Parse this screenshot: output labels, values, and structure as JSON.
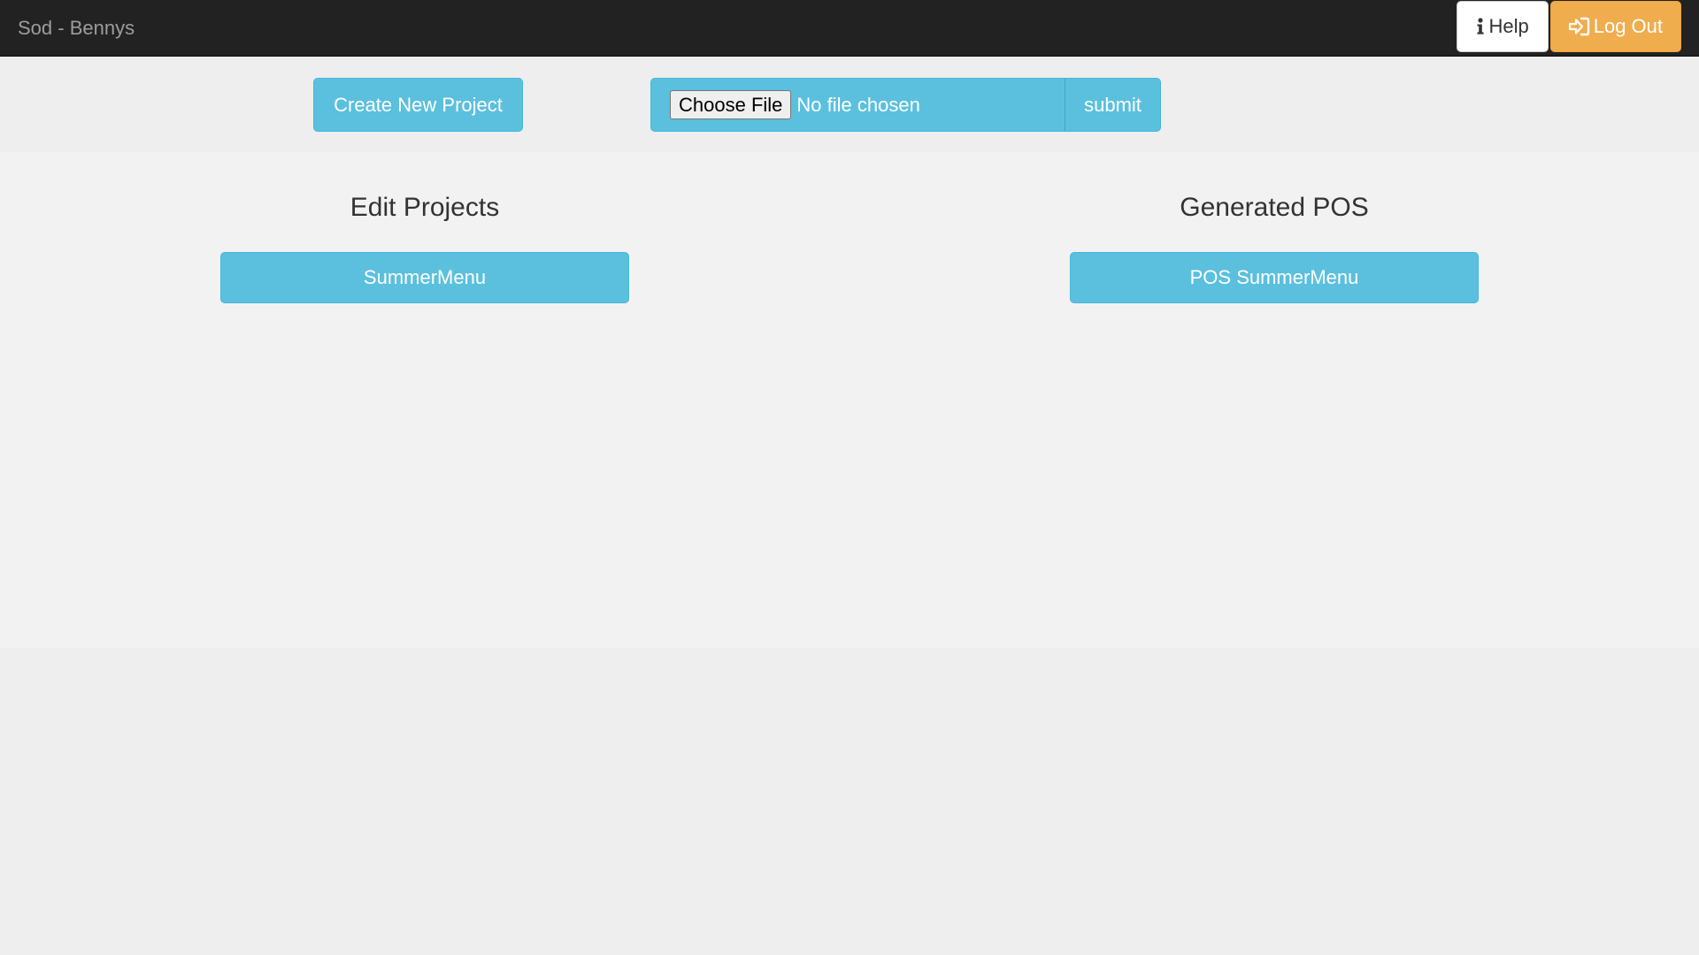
{
  "navbar": {
    "brand": "Sod - Bennys",
    "help_label": "Help",
    "help_icon": "info-icon",
    "logout_label": "Log Out",
    "logout_icon": "sign-in-icon",
    "background_color": "#222222",
    "logout_color": "#f0ad4e"
  },
  "toolbar": {
    "create_label": "Create New Project",
    "choose_file_label": "Choose File",
    "file_status": "No file chosen",
    "submit_label": "submit",
    "accent_color": "#5bc0de"
  },
  "edit_projects": {
    "title": "Edit Projects",
    "items": [
      {
        "label": "SummerMenu"
      }
    ]
  },
  "generated_pos": {
    "title": "Generated POS",
    "items": [
      {
        "label": "POS SummerMenu"
      }
    ]
  }
}
